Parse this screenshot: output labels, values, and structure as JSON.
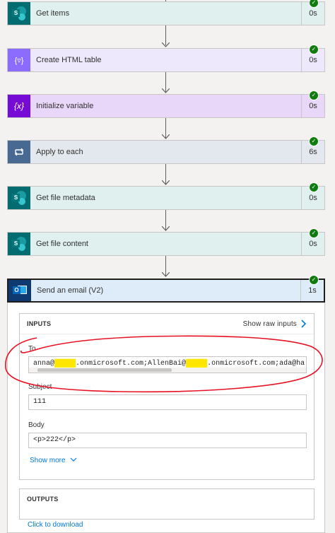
{
  "steps": [
    {
      "title": "Get items",
      "duration": "0s",
      "icon": "sharepoint-icon"
    },
    {
      "title": "Create HTML table",
      "duration": "0s",
      "icon": "data-operation-icon"
    },
    {
      "title": "Initialize variable",
      "duration": "0s",
      "icon": "variable-icon"
    },
    {
      "title": "Apply to each",
      "duration": "6s",
      "icon": "loop-icon"
    },
    {
      "title": "Get file metadata",
      "duration": "0s",
      "icon": "sharepoint-icon"
    },
    {
      "title": "Get file content",
      "duration": "0s",
      "icon": "sharepoint-icon"
    }
  ],
  "email_step": {
    "title": "Send an email (V2)",
    "duration": "1s",
    "icon": "outlook-icon"
  },
  "inputs": {
    "header": "INPUTS",
    "show_raw": "Show raw inputs",
    "to_label": "To",
    "to_parts": [
      "anna@",
      "█████",
      ".onmicrosoft.com;AllenBai@",
      "█████",
      ".onmicrosoft.com;ada@ha"
    ],
    "subject_label": "Subject",
    "subject_value": "111",
    "body_label": "Body",
    "body_value": "<p>222</p>",
    "show_more": "Show more"
  },
  "outputs": {
    "header": "OUTPUTS",
    "download_link": "Click to download"
  },
  "colors": {
    "sharepoint": "#036c70",
    "data_operation": "#8c6cff",
    "variable": "#770bd6",
    "loop": "#486991",
    "annotation": "#e81123",
    "success": "#107c10"
  }
}
